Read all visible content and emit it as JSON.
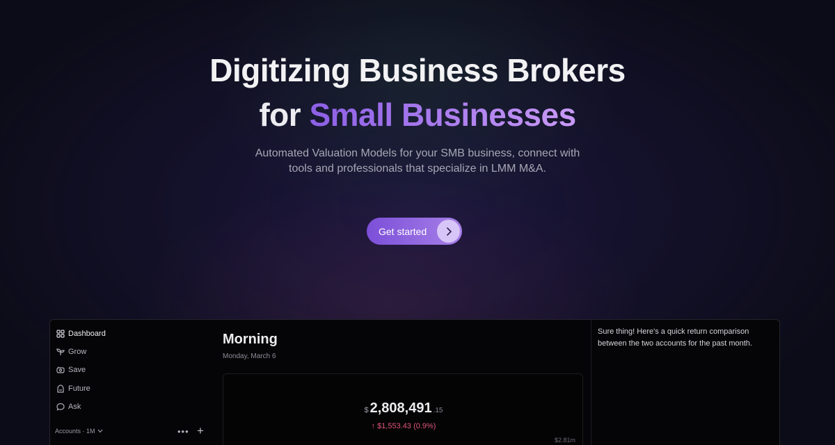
{
  "hero": {
    "title_line1": "Digitizing Business Brokers",
    "title_line2_plain": "for ",
    "title_line2_accent": "Small Businesses",
    "subtitle": "Automated Valuation Models for your SMB business, connect with tools and professionals that specialize in LMM M&A.",
    "cta_label": "Get started",
    "cta_icon": "chevron-right-icon"
  },
  "app": {
    "sidebar": {
      "items": [
        {
          "label": "Dashboard",
          "icon": "grid-icon",
          "active": true
        },
        {
          "label": "Grow",
          "icon": "sprout-icon",
          "active": false
        },
        {
          "label": "Save",
          "icon": "piggy-bank-icon",
          "active": false
        },
        {
          "label": "Future",
          "icon": "hourglass-icon",
          "active": false
        },
        {
          "label": "Ask",
          "icon": "chat-bubble-icon",
          "active": false
        }
      ],
      "accounts_label": "Accounts · 1M",
      "more_label": "•••",
      "add_label": "+"
    },
    "main": {
      "greeting": "Morning",
      "date": "Monday, March 6",
      "balance": {
        "currency": "$",
        "amount": "2,808,491",
        "cents": ".15",
        "change": "↑ $1,553.43 (0.9%)",
        "change_color": "#e0557a",
        "axis_max": "$2.81m"
      }
    },
    "chat": {
      "message": "Sure thing! Here's a quick return comparison between the two accounts for the past month."
    }
  },
  "colors": {
    "background": "#0c0c18",
    "accent_start": "#7c4fd8",
    "accent_end": "#a780e8"
  }
}
